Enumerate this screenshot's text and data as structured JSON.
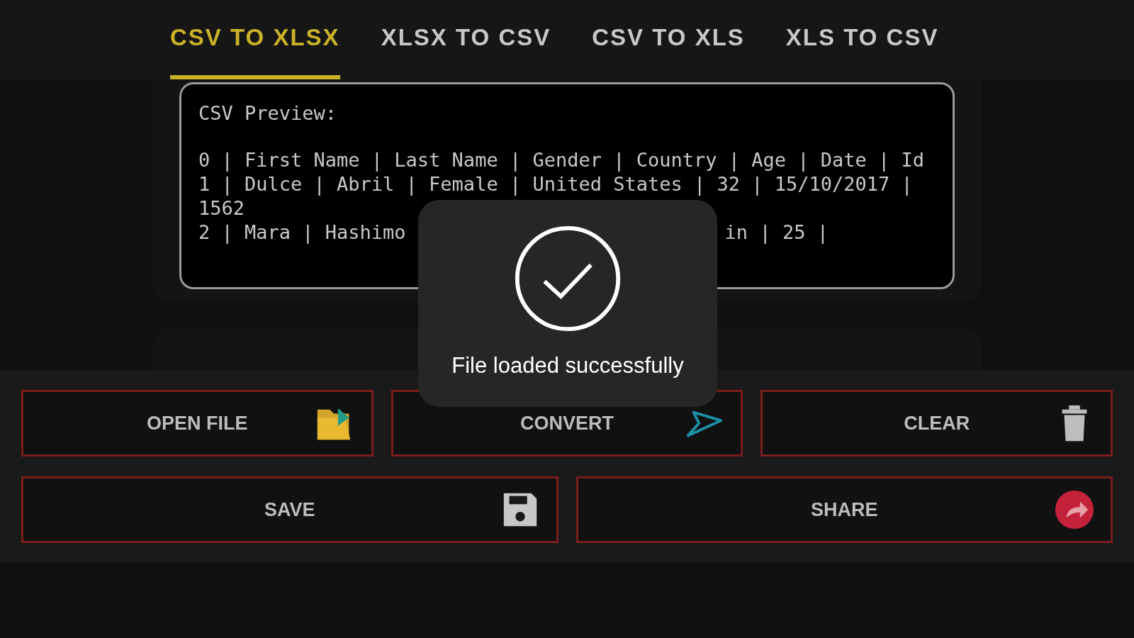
{
  "tabs": [
    {
      "label": "CSV TO XLSX",
      "selected": true
    },
    {
      "label": "XLSX TO CSV",
      "selected": false
    },
    {
      "label": "CSV TO XLS",
      "selected": false
    },
    {
      "label": "XLS TO CSV",
      "selected": false
    }
  ],
  "preview": {
    "title": "CSV Preview:",
    "lines": [
      "0 | First Name | Last Name | Gender | Country | Age | Date | Id",
      "1 | Dulce | Abril | Female | United States | 32 | 15/10/2017 | 1562"
    ],
    "partial_line": [
      "2 | Mara | Hashimo",
      "in | 25 |"
    ]
  },
  "button_rows": [
    [
      {
        "label": "OPEN FILE",
        "kind": "folder"
      },
      {
        "label": "CONVERT",
        "kind": "send"
      },
      {
        "label": "CLEAR",
        "kind": "trash"
      }
    ],
    [
      {
        "label": "SAVE",
        "kind": "floppy"
      },
      {
        "label": "SHARE",
        "kind": "share"
      }
    ]
  ],
  "toast": {
    "message": "File loaded successfully"
  }
}
